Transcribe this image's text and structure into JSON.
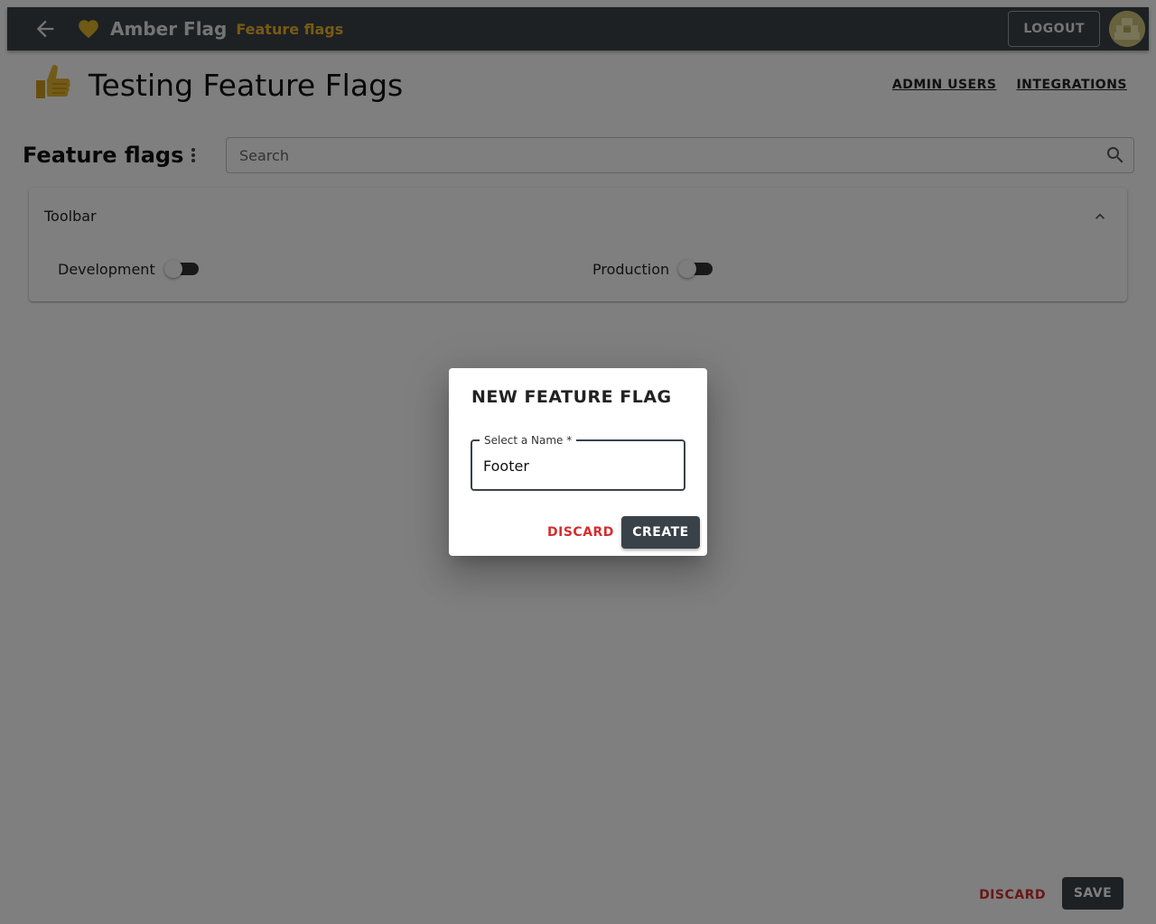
{
  "appbar": {
    "brand": "Amber Flag",
    "section": "Feature flags",
    "logout_label": "LOGOUT",
    "brand_color": "#f0b429",
    "bar_color": "#3a4249"
  },
  "project": {
    "title": "Testing Feature Flags",
    "icon": "thumbs-up-icon",
    "links": [
      "ADMIN USERS",
      "INTEGRATIONS"
    ]
  },
  "flags_section": {
    "title": "Feature flags",
    "search_placeholder": "Search"
  },
  "flags": [
    {
      "name": "Toolbar",
      "environments": [
        {
          "label": "Development",
          "enabled": false
        },
        {
          "label": "Production",
          "enabled": false
        }
      ]
    }
  ],
  "footer": {
    "discard_label": "DISCARD",
    "save_label": "SAVE"
  },
  "dialog": {
    "title": "NEW FEATURE FLAG",
    "field_label": "Select a Name",
    "required_mark": "*",
    "field_value": "Footer",
    "discard_label": "DISCARD",
    "create_label": "CREATE",
    "discard_color": "#d32f2f"
  }
}
